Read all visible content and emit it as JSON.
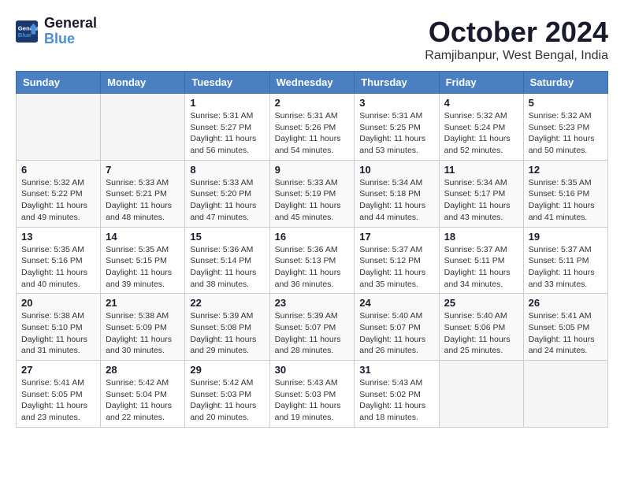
{
  "header": {
    "logo_line1": "General",
    "logo_line2": "Blue",
    "month_year": "October 2024",
    "location": "Ramjibanpur, West Bengal, India"
  },
  "weekdays": [
    "Sunday",
    "Monday",
    "Tuesday",
    "Wednesday",
    "Thursday",
    "Friday",
    "Saturday"
  ],
  "weeks": [
    [
      {
        "day": "",
        "info": ""
      },
      {
        "day": "",
        "info": ""
      },
      {
        "day": "1",
        "info": "Sunrise: 5:31 AM\nSunset: 5:27 PM\nDaylight: 11 hours and 56 minutes."
      },
      {
        "day": "2",
        "info": "Sunrise: 5:31 AM\nSunset: 5:26 PM\nDaylight: 11 hours and 54 minutes."
      },
      {
        "day": "3",
        "info": "Sunrise: 5:31 AM\nSunset: 5:25 PM\nDaylight: 11 hours and 53 minutes."
      },
      {
        "day": "4",
        "info": "Sunrise: 5:32 AM\nSunset: 5:24 PM\nDaylight: 11 hours and 52 minutes."
      },
      {
        "day": "5",
        "info": "Sunrise: 5:32 AM\nSunset: 5:23 PM\nDaylight: 11 hours and 50 minutes."
      }
    ],
    [
      {
        "day": "6",
        "info": "Sunrise: 5:32 AM\nSunset: 5:22 PM\nDaylight: 11 hours and 49 minutes."
      },
      {
        "day": "7",
        "info": "Sunrise: 5:33 AM\nSunset: 5:21 PM\nDaylight: 11 hours and 48 minutes."
      },
      {
        "day": "8",
        "info": "Sunrise: 5:33 AM\nSunset: 5:20 PM\nDaylight: 11 hours and 47 minutes."
      },
      {
        "day": "9",
        "info": "Sunrise: 5:33 AM\nSunset: 5:19 PM\nDaylight: 11 hours and 45 minutes."
      },
      {
        "day": "10",
        "info": "Sunrise: 5:34 AM\nSunset: 5:18 PM\nDaylight: 11 hours and 44 minutes."
      },
      {
        "day": "11",
        "info": "Sunrise: 5:34 AM\nSunset: 5:17 PM\nDaylight: 11 hours and 43 minutes."
      },
      {
        "day": "12",
        "info": "Sunrise: 5:35 AM\nSunset: 5:16 PM\nDaylight: 11 hours and 41 minutes."
      }
    ],
    [
      {
        "day": "13",
        "info": "Sunrise: 5:35 AM\nSunset: 5:16 PM\nDaylight: 11 hours and 40 minutes."
      },
      {
        "day": "14",
        "info": "Sunrise: 5:35 AM\nSunset: 5:15 PM\nDaylight: 11 hours and 39 minutes."
      },
      {
        "day": "15",
        "info": "Sunrise: 5:36 AM\nSunset: 5:14 PM\nDaylight: 11 hours and 38 minutes."
      },
      {
        "day": "16",
        "info": "Sunrise: 5:36 AM\nSunset: 5:13 PM\nDaylight: 11 hours and 36 minutes."
      },
      {
        "day": "17",
        "info": "Sunrise: 5:37 AM\nSunset: 5:12 PM\nDaylight: 11 hours and 35 minutes."
      },
      {
        "day": "18",
        "info": "Sunrise: 5:37 AM\nSunset: 5:11 PM\nDaylight: 11 hours and 34 minutes."
      },
      {
        "day": "19",
        "info": "Sunrise: 5:37 AM\nSunset: 5:11 PM\nDaylight: 11 hours and 33 minutes."
      }
    ],
    [
      {
        "day": "20",
        "info": "Sunrise: 5:38 AM\nSunset: 5:10 PM\nDaylight: 11 hours and 31 minutes."
      },
      {
        "day": "21",
        "info": "Sunrise: 5:38 AM\nSunset: 5:09 PM\nDaylight: 11 hours and 30 minutes."
      },
      {
        "day": "22",
        "info": "Sunrise: 5:39 AM\nSunset: 5:08 PM\nDaylight: 11 hours and 29 minutes."
      },
      {
        "day": "23",
        "info": "Sunrise: 5:39 AM\nSunset: 5:07 PM\nDaylight: 11 hours and 28 minutes."
      },
      {
        "day": "24",
        "info": "Sunrise: 5:40 AM\nSunset: 5:07 PM\nDaylight: 11 hours and 26 minutes."
      },
      {
        "day": "25",
        "info": "Sunrise: 5:40 AM\nSunset: 5:06 PM\nDaylight: 11 hours and 25 minutes."
      },
      {
        "day": "26",
        "info": "Sunrise: 5:41 AM\nSunset: 5:05 PM\nDaylight: 11 hours and 24 minutes."
      }
    ],
    [
      {
        "day": "27",
        "info": "Sunrise: 5:41 AM\nSunset: 5:05 PM\nDaylight: 11 hours and 23 minutes."
      },
      {
        "day": "28",
        "info": "Sunrise: 5:42 AM\nSunset: 5:04 PM\nDaylight: 11 hours and 22 minutes."
      },
      {
        "day": "29",
        "info": "Sunrise: 5:42 AM\nSunset: 5:03 PM\nDaylight: 11 hours and 20 minutes."
      },
      {
        "day": "30",
        "info": "Sunrise: 5:43 AM\nSunset: 5:03 PM\nDaylight: 11 hours and 19 minutes."
      },
      {
        "day": "31",
        "info": "Sunrise: 5:43 AM\nSunset: 5:02 PM\nDaylight: 11 hours and 18 minutes."
      },
      {
        "day": "",
        "info": ""
      },
      {
        "day": "",
        "info": ""
      }
    ]
  ]
}
